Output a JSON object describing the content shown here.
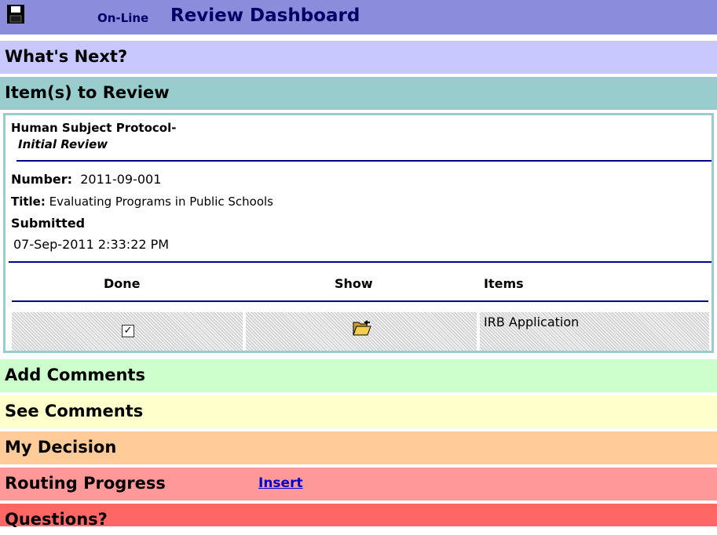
{
  "header": {
    "prefix": "On-Line",
    "title": "Review Dashboard",
    "save_icon": "floppy-disk-icon"
  },
  "sections": {
    "whats_next": "What's Next?",
    "items_to_review": "Item(s) to Review",
    "add_comments": "Add Comments",
    "see_comments": "See Comments",
    "my_decision": "My Decision",
    "routing_progress": "Routing Progress",
    "insert_link": "Insert",
    "questions": "Questions?"
  },
  "protocol": {
    "type": "Human Subject Protocol-",
    "review": "Initial Review",
    "number_label": "Number:",
    "number": "2011-09-001",
    "title_label": "Title:",
    "title": "Evaluating Programs in Public Schools",
    "submitted_label": "Submitted",
    "submitted": "07-Sep-2011 2:33:22 PM"
  },
  "table": {
    "headers": [
      "Done",
      "Show",
      "Items"
    ],
    "rows": [
      {
        "done": true,
        "show_icon": "open-folder-icon",
        "item": "IRB Application"
      }
    ]
  },
  "colors": {
    "header": "#8c8cdc",
    "whats_next": "#c8c8ff",
    "items_to_review": "#99cccc",
    "add_comments": "#ccffcc",
    "see_comments": "#ffffcc",
    "my_decision": "#ffcc99",
    "routing_progress": "#ff9999",
    "questions": "#ff6666"
  }
}
